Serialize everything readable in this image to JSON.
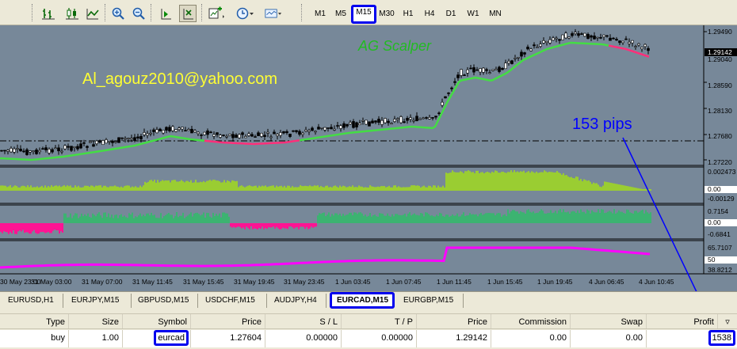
{
  "toolbar": {
    "timeframes": [
      "M1",
      "M5",
      "M15",
      "M30",
      "H1",
      "H4",
      "D1",
      "W1",
      "MN"
    ],
    "active_timeframe": "M15",
    "icons": [
      "bar-chart-icon",
      "candlestick-icon",
      "line-chart-icon",
      "zoom-in-icon",
      "zoom-out-icon",
      "chart-shift-icon",
      "autoscroll-icon",
      "indicators-icon",
      "periodicity-icon",
      "templates-icon"
    ]
  },
  "chart": {
    "title": "AG Scalper",
    "email": "Al_agouz2010@yahoo.com",
    "annotation": "153 pips",
    "price_labels": [
      "1.29490",
      "1.29142",
      "1.29040",
      "1.28590",
      "1.28130",
      "1.27680",
      "1.27220"
    ],
    "current_price": "1.29142",
    "ind1_labels": [
      "0.002473",
      "0.00",
      "-0.00129"
    ],
    "ind2_labels": [
      "0.7154",
      "0.00",
      "-0.6841"
    ],
    "ind3_labels": [
      "65.7107",
      "50",
      "38.8212"
    ],
    "time_labels": [
      "30 May 23:00",
      "31 May 03:00",
      "31 May 07:00",
      "31 May 11:45",
      "31 May 15:45",
      "31 May 19:45",
      "31 May 23:45",
      "1 Jun 03:45",
      "1 Jun 07:45",
      "1 Jun 11:45",
      "1 Jun 15:45",
      "1 Jun 19:45",
      "4 Jun 06:45",
      "4 Jun 10:45"
    ],
    "colors": {
      "background": "#778899",
      "candle": "#000000",
      "ma_up": "#44dd44",
      "ma_down": "#ff2f7a",
      "hist1": "#9acd32",
      "hist2_pos": "#3cb371",
      "hist2_neg": "#ff1493",
      "line3": "#ff00ff",
      "annotation": "#0000ff"
    }
  },
  "tabs": {
    "items": [
      "EURUSD,H1",
      "EURJPY,M15",
      "GBPUSD,M15",
      "USDCHF,M15",
      "AUDJPY,H4",
      "EURCAD,M15",
      "EURGBP,M15"
    ],
    "active": "EURCAD,M15"
  },
  "trade_table": {
    "headers": [
      "Type",
      "Size",
      "Symbol",
      "Price",
      "S / L",
      "T / P",
      "Price",
      "Commission",
      "Swap",
      "Profit"
    ],
    "row": [
      "buy",
      "1.00",
      "eurcad",
      "1.27604",
      "0.00000",
      "0.00000",
      "1.29142",
      "0.00",
      "0.00",
      "1538"
    ]
  }
}
